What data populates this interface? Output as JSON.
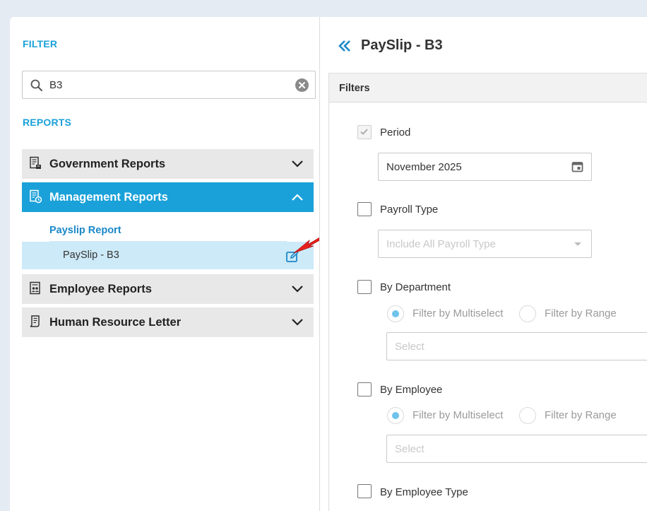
{
  "sidebar": {
    "filter_label": "FILTER",
    "search": {
      "value": "B3",
      "placeholder": ""
    },
    "reports_label": "REPORTS",
    "groups": [
      {
        "label": "Government Reports",
        "icon": "government-report-icon",
        "expanded": false
      },
      {
        "label": "Management Reports",
        "icon": "management-report-icon",
        "expanded": true
      },
      {
        "label": "Employee Reports",
        "icon": "employee-report-icon",
        "expanded": false
      },
      {
        "label": "Human Resource Letter",
        "icon": "letter-icon",
        "expanded": false
      }
    ],
    "subgroup": {
      "label": "Payslip Report",
      "items": [
        {
          "label": "PaySlip - B3",
          "icon": "edit-icon"
        }
      ]
    }
  },
  "main": {
    "title": "PaySlip - B3",
    "back_icon": "double-chevron-left-icon",
    "filters_title": "Filters",
    "period": {
      "label": "Period",
      "checked": true,
      "value": "November 2025",
      "icon": "calendar-icon"
    },
    "payroll_type": {
      "label": "Payroll Type",
      "checked": false,
      "placeholder": "Include All Payroll Type"
    },
    "by_department": {
      "label": "By Department",
      "checked": false,
      "radio_multi": "Filter by Multiselect",
      "radio_range": "Filter by Range",
      "select_placeholder": "Select"
    },
    "by_employee": {
      "label": "By Employee",
      "checked": false,
      "radio_multi": "Filter by Multiselect",
      "radio_range": "Filter by Range",
      "select_placeholder": "Select"
    },
    "by_employee_type": {
      "label": "By Employee Type",
      "checked": false
    }
  },
  "colors": {
    "accent": "#1aa1d9",
    "active_row": "#cdeaf8",
    "annotation_arrow": "#e8201c"
  }
}
